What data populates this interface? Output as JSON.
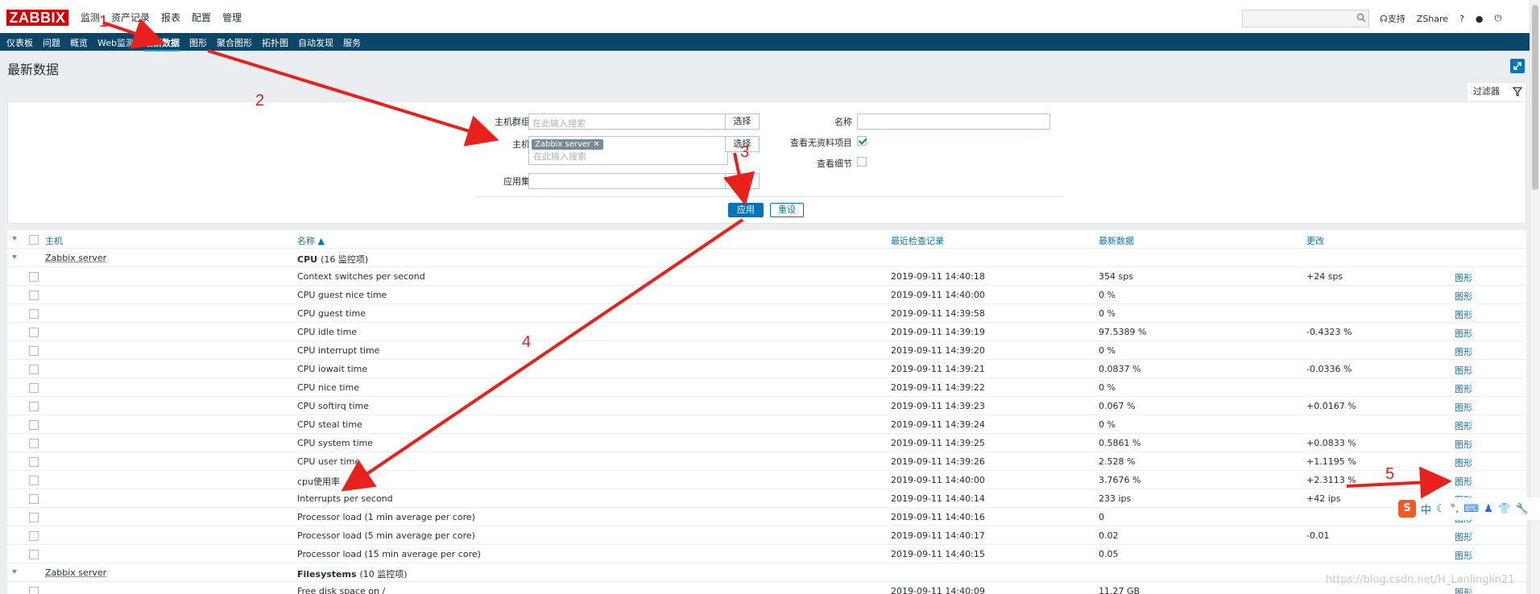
{
  "header": {
    "logo": "ZABBIX",
    "main_menu": [
      "监测",
      "资产记录",
      "报表",
      "配置",
      "管理"
    ],
    "support": "支持",
    "share": "Share",
    "help": "?"
  },
  "submenu": [
    "仪表板",
    "问题",
    "概览",
    "Web监测",
    "最新数据",
    "图形",
    "聚合图形",
    "拓扑图",
    "自动发现",
    "服务"
  ],
  "page_title": "最新数据",
  "filter": {
    "tab_label": "过滤器",
    "host_group_label": "主机群组",
    "host_group_placeholder": "在此输入搜索",
    "select_label": "选择",
    "host_label": "主机",
    "host_tag": "Zabbix server",
    "host_placeholder": "在此输入搜索",
    "app_label": "应用集",
    "name_label": "名称",
    "show_no_data_label": "查看无资料项目",
    "show_no_data_checked": true,
    "show_details_label": "查看细节",
    "show_details_checked": false,
    "apply_label": "应用",
    "reset_label": "重设"
  },
  "table": {
    "headers": [
      "主机",
      "名称 ▲",
      "最近检查记录",
      "最新数据",
      "更改"
    ],
    "graph_label": "图形",
    "groups": [
      {
        "host": "Zabbix server",
        "app": "CPU",
        "count": "(16 监控项)",
        "rows": [
          {
            "name": "Context switches per second",
            "time": "2019-09-11 14:40:18",
            "value": "354 sps",
            "change": "+24 sps"
          },
          {
            "name": "CPU guest nice time",
            "time": "2019-09-11 14:40:00",
            "value": "0 %",
            "change": ""
          },
          {
            "name": "CPU guest time",
            "time": "2019-09-11 14:39:58",
            "value": "0 %",
            "change": ""
          },
          {
            "name": "CPU idle time",
            "time": "2019-09-11 14:39:19",
            "value": "97.5389 %",
            "change": "-0.4323 %"
          },
          {
            "name": "CPU interrupt time",
            "time": "2019-09-11 14:39:20",
            "value": "0 %",
            "change": ""
          },
          {
            "name": "CPU iowait time",
            "time": "2019-09-11 14:39:21",
            "value": "0.0837 %",
            "change": "-0.0336 %"
          },
          {
            "name": "CPU nice time",
            "time": "2019-09-11 14:39:22",
            "value": "0 %",
            "change": ""
          },
          {
            "name": "CPU softirq time",
            "time": "2019-09-11 14:39:23",
            "value": "0.067 %",
            "change": "+0.0167 %"
          },
          {
            "name": "CPU steal time",
            "time": "2019-09-11 14:39:24",
            "value": "0 %",
            "change": ""
          },
          {
            "name": "CPU system time",
            "time": "2019-09-11 14:39:25",
            "value": "0.5861 %",
            "change": "+0.0833 %"
          },
          {
            "name": "CPU user time",
            "time": "2019-09-11 14:39:26",
            "value": "2.528 %",
            "change": "+1.1195 %"
          },
          {
            "name": "cpu使用率",
            "time": "2019-09-11 14:40:00",
            "value": "3.7676 %",
            "change": "+2.3113 %"
          },
          {
            "name": "Interrupts per second",
            "time": "2019-09-11 14:40:14",
            "value": "233 ips",
            "change": "+42 ips"
          },
          {
            "name": "Processor load (1 min average per core)",
            "time": "2019-09-11 14:40:16",
            "value": "0",
            "change": ""
          },
          {
            "name": "Processor load (5 min average per core)",
            "time": "2019-09-11 14:40:17",
            "value": "0.02",
            "change": "-0.01"
          },
          {
            "name": "Processor load (15 min average per core)",
            "time": "2019-09-11 14:40:15",
            "value": "0.05",
            "change": ""
          }
        ]
      },
      {
        "host": "Zabbix server",
        "app": "Filesystems",
        "count": "(10 监控项)",
        "rows": [
          {
            "name": "Free disk space on /",
            "time": "2019-09-11 14:40:09",
            "value": "11.27 GB",
            "change": ""
          }
        ]
      }
    ]
  },
  "annotations": [
    "1",
    "2",
    "3",
    "4",
    "5"
  ],
  "ime_label": "中",
  "watermark": "https://blog.csdn.net/H_Lanlinglin21",
  "colors": {
    "brand": "#d40000",
    "nav": "#0a466a",
    "link": "#0275b8",
    "annotation": "#e8211c"
  }
}
